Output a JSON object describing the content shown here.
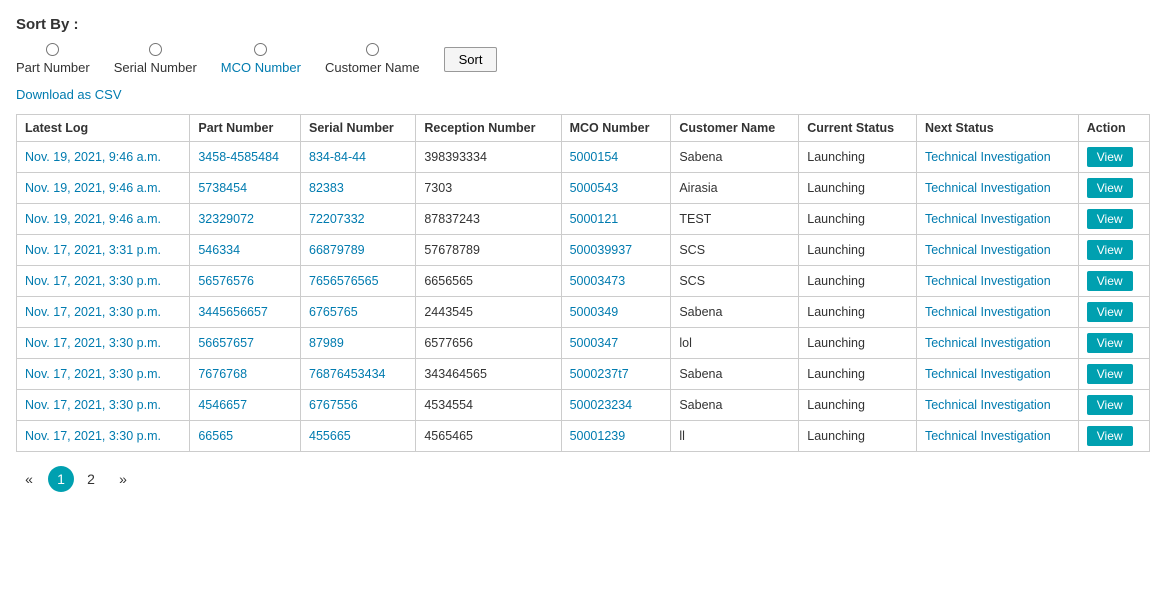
{
  "sortSection": {
    "label": "Sort By :",
    "options": [
      {
        "id": "opt-part",
        "label": "Part Number",
        "isBlue": false
      },
      {
        "id": "opt-serial",
        "label": "Serial Number",
        "isBlue": false
      },
      {
        "id": "opt-mco",
        "label": "MCO Number",
        "isBlue": true
      },
      {
        "id": "opt-customer",
        "label": "Customer Name",
        "isBlue": false
      }
    ],
    "sortButtonLabel": "Sort"
  },
  "downloadLink": "Download as CSV",
  "table": {
    "headers": [
      "Latest Log",
      "Part Number",
      "Serial Number",
      "Reception Number",
      "MCO Number",
      "Customer Name",
      "Current Status",
      "Next Status",
      "Action"
    ],
    "rows": [
      {
        "latestLog": "Nov. 19, 2021, 9:46 a.m.",
        "partNumber": "3458-4585484",
        "serialNumber": "834-84-44",
        "receptionNumber": "398393334",
        "mcoNumber": "5000154",
        "customerName": "Sabena",
        "currentStatus": "Launching",
        "nextStatus": "Technical Investigation",
        "action": "View"
      },
      {
        "latestLog": "Nov. 19, 2021, 9:46 a.m.",
        "partNumber": "5738454",
        "serialNumber": "82383",
        "receptionNumber": "7303",
        "mcoNumber": "5000543",
        "customerName": "Airasia",
        "currentStatus": "Launching",
        "nextStatus": "Technical Investigation",
        "action": "View"
      },
      {
        "latestLog": "Nov. 19, 2021, 9:46 a.m.",
        "partNumber": "32329072",
        "serialNumber": "72207332",
        "receptionNumber": "87837243",
        "mcoNumber": "5000121",
        "customerName": "TEST",
        "currentStatus": "Launching",
        "nextStatus": "Technical Investigation",
        "action": "View"
      },
      {
        "latestLog": "Nov. 17, 2021, 3:31 p.m.",
        "partNumber": "546334",
        "serialNumber": "66879789",
        "receptionNumber": "57678789",
        "mcoNumber": "500039937",
        "customerName": "SCS",
        "currentStatus": "Launching",
        "nextStatus": "Technical Investigation",
        "action": "View"
      },
      {
        "latestLog": "Nov. 17, 2021, 3:30 p.m.",
        "partNumber": "56576576",
        "serialNumber": "7656576565",
        "receptionNumber": "6656565",
        "mcoNumber": "50003473",
        "customerName": "SCS",
        "currentStatus": "Launching",
        "nextStatus": "Technical Investigation",
        "action": "View"
      },
      {
        "latestLog": "Nov. 17, 2021, 3:30 p.m.",
        "partNumber": "3445656657",
        "serialNumber": "6765765",
        "receptionNumber": "2443545",
        "mcoNumber": "5000349",
        "customerName": "Sabena",
        "currentStatus": "Launching",
        "nextStatus": "Technical Investigation",
        "action": "View"
      },
      {
        "latestLog": "Nov. 17, 2021, 3:30 p.m.",
        "partNumber": "56657657",
        "serialNumber": "87989",
        "receptionNumber": "6577656",
        "mcoNumber": "5000347",
        "customerName": "lol",
        "currentStatus": "Launching",
        "nextStatus": "Technical Investigation",
        "action": "View"
      },
      {
        "latestLog": "Nov. 17, 2021, 3:30 p.m.",
        "partNumber": "7676768",
        "serialNumber": "76876453434",
        "receptionNumber": "343464565",
        "mcoNumber": "5000237t7",
        "customerName": "Sabena",
        "currentStatus": "Launching",
        "nextStatus": "Technical Investigation",
        "action": "View"
      },
      {
        "latestLog": "Nov. 17, 2021, 3:30 p.m.",
        "partNumber": "4546657",
        "serialNumber": "6767556",
        "receptionNumber": "4534554",
        "mcoNumber": "500023234",
        "customerName": "Sabena",
        "currentStatus": "Launching",
        "nextStatus": "Technical Investigation",
        "action": "View"
      },
      {
        "latestLog": "Nov. 17, 2021, 3:30 p.m.",
        "partNumber": "66565",
        "serialNumber": "455665",
        "receptionNumber": "4565465",
        "mcoNumber": "50001239",
        "customerName": "ll",
        "currentStatus": "Launching",
        "nextStatus": "Technical Investigation",
        "action": "View"
      }
    ]
  },
  "pagination": {
    "prev": "«",
    "next": "»",
    "pages": [
      "1",
      "2"
    ],
    "activePage": "1"
  }
}
